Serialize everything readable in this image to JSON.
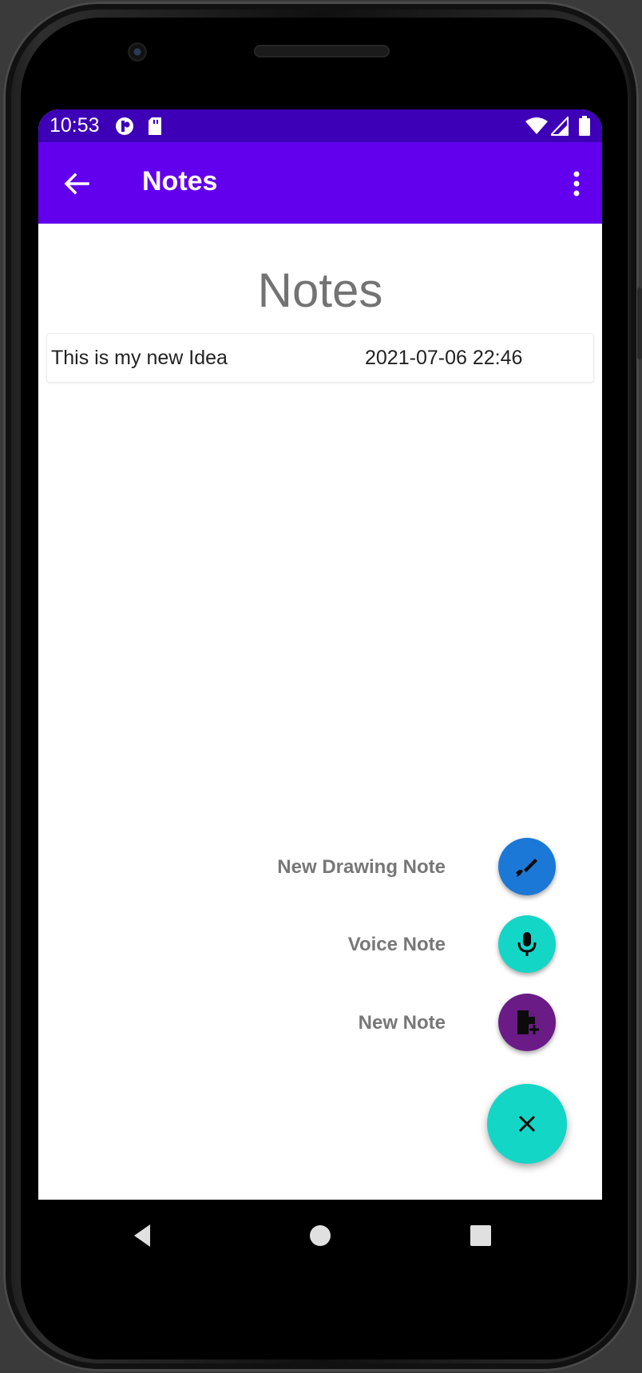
{
  "status_bar": {
    "time": "10:53",
    "left_icons": [
      "app-notification-icon",
      "sd-card-icon"
    ],
    "right_icons": [
      "wifi-icon",
      "signal-icon",
      "battery-icon"
    ]
  },
  "app_bar": {
    "title": "Notes",
    "back_icon": "arrow-back-icon",
    "menu_icon": "more-vert-icon",
    "color": "#6200ee",
    "status_color": "#3d00b6"
  },
  "main": {
    "heading": "Notes",
    "notes": [
      {
        "title": "This is my new Idea",
        "date": "2021-07-06 22:46"
      }
    ]
  },
  "fab_menu": {
    "actions": [
      {
        "label": "New Drawing Note",
        "icon": "brush-icon",
        "color": "#1c78d6"
      },
      {
        "label": "Voice Note",
        "icon": "microphone-icon",
        "color": "#13d6c6"
      },
      {
        "label": "New Note",
        "icon": "note-add-icon",
        "color": "#6a1b86"
      }
    ],
    "main_icon": "close-icon",
    "main_color": "#13d6c6"
  },
  "nav_bar": {
    "buttons": [
      "back-triangle-icon",
      "home-circle-icon",
      "recents-square-icon"
    ]
  }
}
